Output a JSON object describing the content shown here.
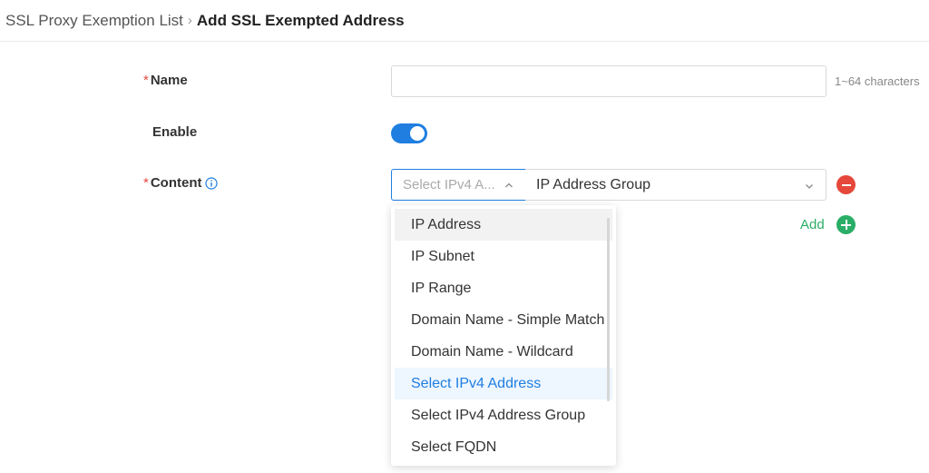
{
  "breadcrumb": {
    "parent": "SSL Proxy Exemption List",
    "separator": "›",
    "current": "Add SSL Exempted Address"
  },
  "form": {
    "name": {
      "required_mark": "*",
      "label": "Name",
      "value": "",
      "hint": "1~64 characters"
    },
    "enable": {
      "label": "Enable",
      "checked": true
    },
    "content": {
      "required_mark": "*",
      "label": "Content",
      "type_select": {
        "placeholder": "Select IPv4 A...",
        "open": true
      },
      "value_select": {
        "value": "IP Address Group"
      },
      "add_label": "Add"
    }
  },
  "dropdown": {
    "options": [
      "IP Address",
      "IP Subnet",
      "IP Range",
      "Domain Name - Simple Match",
      "Domain Name - Wildcard",
      "Select IPv4 Address",
      "Select IPv4 Address Group",
      "Select FQDN"
    ],
    "hovered_index": 0,
    "selected_index": 5
  },
  "colors": {
    "primary": "#1f7ee0",
    "required": "#e5483a",
    "add_green": "#2aae67"
  }
}
